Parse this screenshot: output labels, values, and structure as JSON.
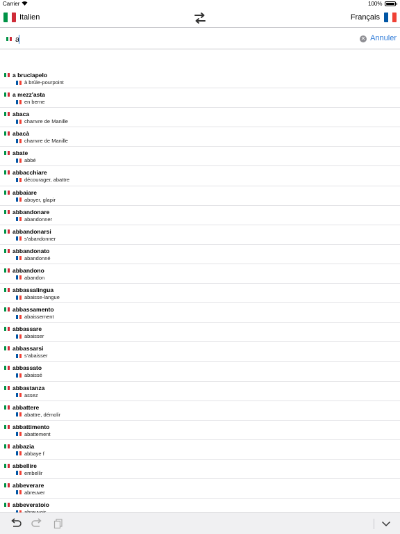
{
  "status_bar": {
    "carrier": "Carrier",
    "time": "",
    "battery": "100%",
    "battery_level": 1.0
  },
  "lang_bar": {
    "source_lang": "Italien",
    "target_lang": "Français",
    "source_flag": "italy-flag-icon",
    "target_flag": "france-flag-icon",
    "swap_icon": "swap-arrows-icon"
  },
  "search": {
    "value": "a",
    "placeholder": "",
    "cancel_label": "Annuler",
    "clear_icon": "clear-circle-icon"
  },
  "colors": {
    "accent": "#2e7bd8",
    "italy": [
      "#009246",
      "#ffffff",
      "#ce2b37"
    ],
    "france": [
      "#0055a4",
      "#ffffff",
      "#ef4135"
    ]
  },
  "results": [
    {
      "term": "a bruciapelo",
      "translation": "à brûle-pourpoint"
    },
    {
      "term": "a mezz'asta",
      "translation": "en berne"
    },
    {
      "term": "abaca",
      "translation": "chanvre de Manille"
    },
    {
      "term": "abacà",
      "translation": "chanvre de Manille"
    },
    {
      "term": "abate",
      "translation": "abbé"
    },
    {
      "term": "abbacchiare",
      "translation": "décourager, abattre"
    },
    {
      "term": "abbaiare",
      "translation": "aboyer, glapir"
    },
    {
      "term": "abbandonare",
      "translation": "abandonner"
    },
    {
      "term": "abbandonarsi",
      "translation": "s'abandonner"
    },
    {
      "term": "abbandonato",
      "translation": "abandonné"
    },
    {
      "term": "abbandono",
      "translation": "abandon"
    },
    {
      "term": "abbassalingua",
      "translation": "abaisse-langue"
    },
    {
      "term": "abbassamento",
      "translation": "abaissement"
    },
    {
      "term": "abbassare",
      "translation": "abaisser"
    },
    {
      "term": "abbassarsi",
      "translation": "s'abaisser"
    },
    {
      "term": "abbassato",
      "translation": "abaissé"
    },
    {
      "term": "abbastanza",
      "translation": "assez"
    },
    {
      "term": "abbattere",
      "translation": "abattre, démolir"
    },
    {
      "term": "abbattimento",
      "translation": "abattement"
    },
    {
      "term": "abbazia",
      "translation": "abbaye f"
    },
    {
      "term": "abbellire",
      "translation": "embellir"
    },
    {
      "term": "abbeverare",
      "translation": "abreuver"
    },
    {
      "term": "abbeveratoio",
      "translation": "abreuvoir"
    }
  ],
  "toolbar": {
    "undo_icon": "undo-icon",
    "redo_icon": "redo-icon",
    "copy_icon": "copy-icon",
    "collapse_icon": "chevron-down-icon"
  }
}
